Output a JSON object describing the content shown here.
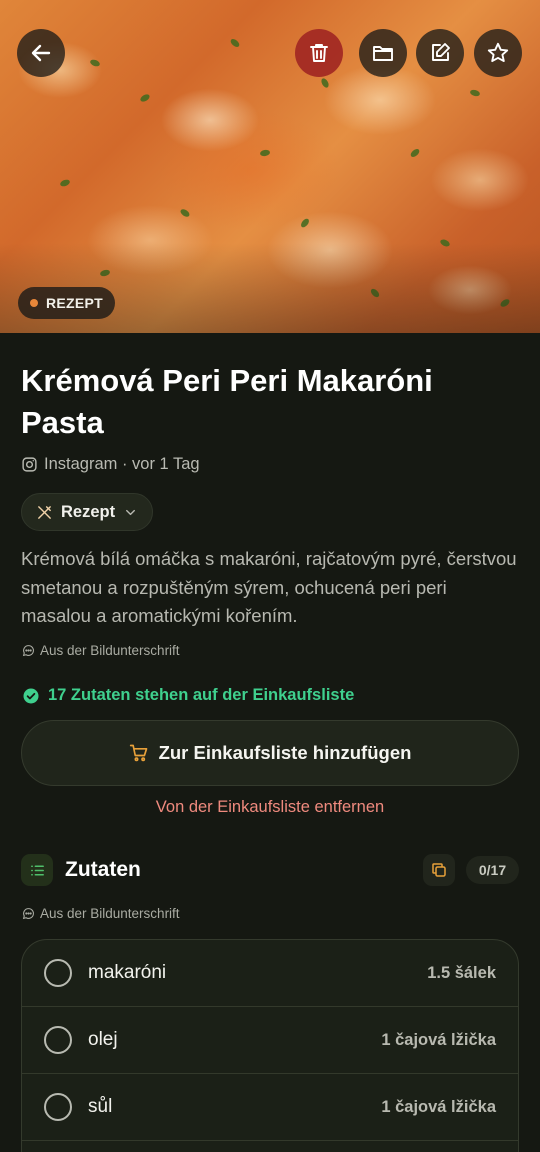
{
  "hero": {
    "image_alt": "Pasta dish photo",
    "badge_label": "REZEPT",
    "badge_dot_color": "#e8873a",
    "actions": [
      {
        "icon": "arrow-left-icon",
        "label": "back"
      },
      {
        "icon": "trash-icon",
        "label": "delete"
      },
      {
        "icon": "folder-icon",
        "label": "folder"
      },
      {
        "icon": "edit-icon",
        "label": "edit"
      },
      {
        "icon": "star-icon",
        "label": "favorite"
      }
    ]
  },
  "recipe": {
    "title": "Krémová Peri Peri Makaróni Pasta",
    "source_icon": "instagram-icon",
    "source_meta": "Instagram · vor 1 Tag",
    "type_label": "Rezept",
    "description": "Krémová bílá omáčka s makaróni, rajčatovým pyré, čerstvou smetanou a rozpuštěným sýrem, ochucená peri peri masalou a aromatickými kořením.",
    "caption_source": "Aus der Bildunterschrift"
  },
  "shopping": {
    "status": "17 Zutaten stehen auf der Einkaufsliste",
    "status_color": "#3fd08e",
    "add_button": "Zur Einkaufsliste hinzufügen",
    "remove_link": "Von der Einkaufsliste entfernen",
    "remove_color": "#ef8a7e"
  },
  "ingredients": {
    "title": "Zutaten",
    "counter": "0/17",
    "caption_source": "Aus der Bildunterschrift",
    "items": [
      {
        "name": "makaróni",
        "qty": "1.5 šálek"
      },
      {
        "name": "olej",
        "qty": "1 čajová lžička"
      },
      {
        "name": "sůl",
        "qty": "1 čajová lžička"
      }
    ]
  },
  "colors": {
    "background": "#151812",
    "accent_orange": "#e8873a",
    "delete_red": "#a02622"
  }
}
